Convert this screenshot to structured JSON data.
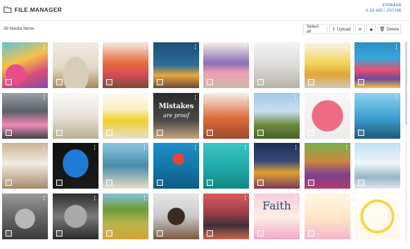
{
  "app": {
    "title": "FILE MANAGER"
  },
  "storage": {
    "label": "STORAGE",
    "value": "5.58 MB / 250 MB",
    "color": "#3a8bd8"
  },
  "toolbar": {
    "item_count": "30 Media Items",
    "select_all": "Select all",
    "upload": "Upload",
    "delete": "Delete",
    "dropbox_icon": "dropbox-icon",
    "drive_icon": "google-drive-icon"
  },
  "media": [
    {
      "name": "colorful-living-room"
    },
    {
      "name": "beige-living-room"
    },
    {
      "name": "orange-living-room"
    },
    {
      "name": "blue-living-room"
    },
    {
      "name": "pastel-living-room"
    },
    {
      "name": "white-living-room"
    },
    {
      "name": "yellow-living-room"
    },
    {
      "name": "patchwork-bedroom"
    },
    {
      "name": "grey-living-room"
    },
    {
      "name": "white-bookshelf-room"
    },
    {
      "name": "yellow-armchair-room"
    },
    {
      "name": "girl-with-sign"
    },
    {
      "name": "orange-kitchen"
    },
    {
      "name": "couple-on-cliff"
    },
    {
      "name": "pink-sweater"
    },
    {
      "name": "people-on-rocks"
    },
    {
      "name": "modern-interior"
    },
    {
      "name": "betta-fish"
    },
    {
      "name": "kids-in-water"
    },
    {
      "name": "swimmer"
    },
    {
      "name": "kids-in-pool"
    },
    {
      "name": "kids-dancing"
    },
    {
      "name": "girls-smiling"
    },
    {
      "name": "kids-on-bikes"
    },
    {
      "name": "boy-with-hat"
    },
    {
      "name": "elderly-man"
    },
    {
      "name": "rice-terraces"
    },
    {
      "name": "group-selfie"
    },
    {
      "name": "crowd-of-children"
    },
    {
      "name": "faith-quote"
    },
    {
      "name": "floral-quote-card"
    },
    {
      "name": "floral-wreath-quote"
    }
  ],
  "overlays": {
    "poster_line1": "Mistakes",
    "poster_line2": "are proof",
    "faith_word": "Faith"
  }
}
